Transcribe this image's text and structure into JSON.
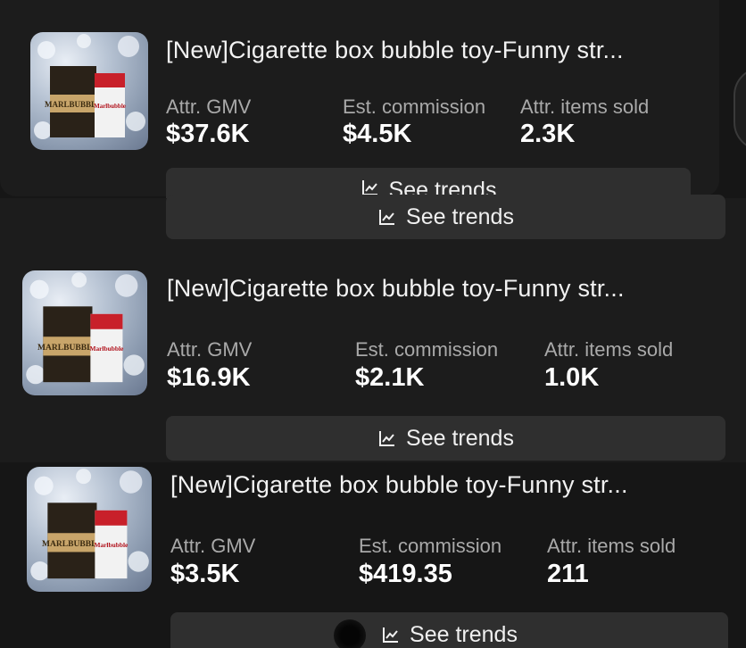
{
  "labels": {
    "gmv": "Attr. GMV",
    "commission": "Est. commission",
    "items_sold": "Attr. items sold",
    "see_trends": "See trends"
  },
  "products": [
    {
      "title": "[New]Cigarette box bubble toy-Funny str...",
      "gmv": "$37.6K",
      "commission": "$4.5K",
      "items_sold": "2.3K"
    },
    {
      "title": "[New]Cigarette box bubble toy-Funny str...",
      "gmv": "$16.9K",
      "commission": "$2.1K",
      "items_sold": "1.0K"
    },
    {
      "title": "[New]Cigarette box bubble toy-Funny str...",
      "gmv": "$3.5K",
      "commission": "$419.35",
      "items_sold": "211"
    }
  ],
  "thumbnail": {
    "box_left_text": "MARLBUBBLE",
    "box_right_text": "Marlbubble"
  },
  "colors": {
    "background": "#161616",
    "card": "#1c1c1c",
    "button": "#2f2f2f",
    "label": "#a9a9a9"
  }
}
